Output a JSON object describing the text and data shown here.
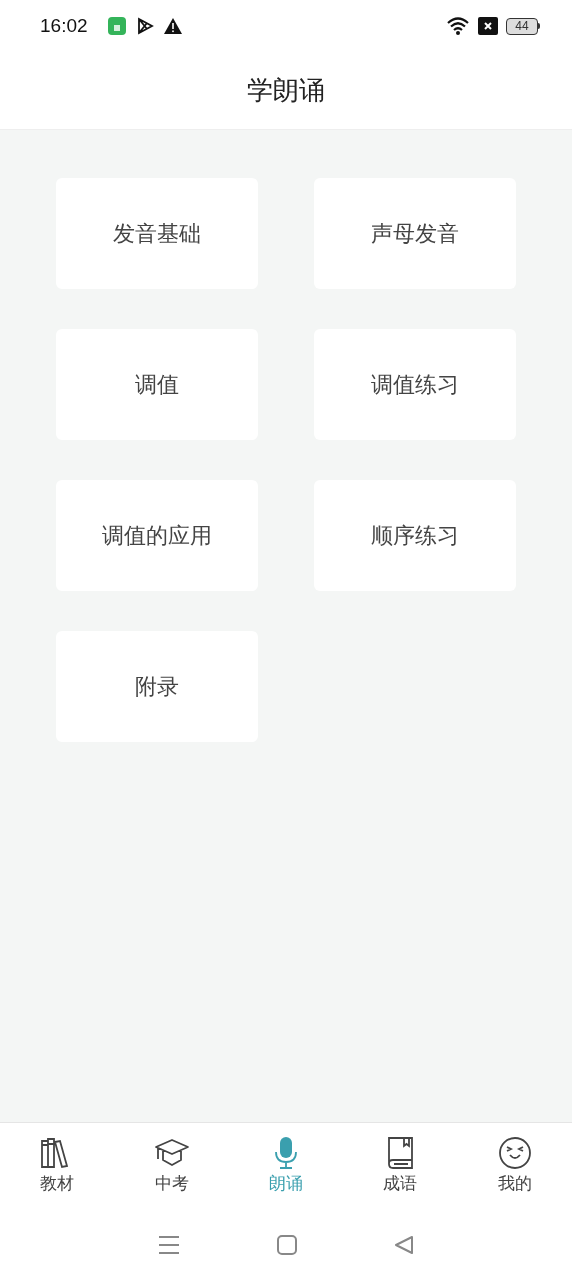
{
  "status_bar": {
    "time": "16:02",
    "battery": "44"
  },
  "header": {
    "title": "学朗诵"
  },
  "cards": [
    {
      "label": "发音基础"
    },
    {
      "label": "声母发音"
    },
    {
      "label": "调值"
    },
    {
      "label": "调值练习"
    },
    {
      "label": "调值的应用"
    },
    {
      "label": "顺序练习"
    },
    {
      "label": "附录"
    }
  ],
  "tabs": [
    {
      "label": "教材",
      "kind": "books",
      "selected": false
    },
    {
      "label": "中考",
      "kind": "cap",
      "selected": false
    },
    {
      "label": "朗诵",
      "kind": "mic",
      "selected": true
    },
    {
      "label": "成语",
      "kind": "book",
      "selected": false
    },
    {
      "label": "我的",
      "kind": "face",
      "selected": false
    }
  ]
}
